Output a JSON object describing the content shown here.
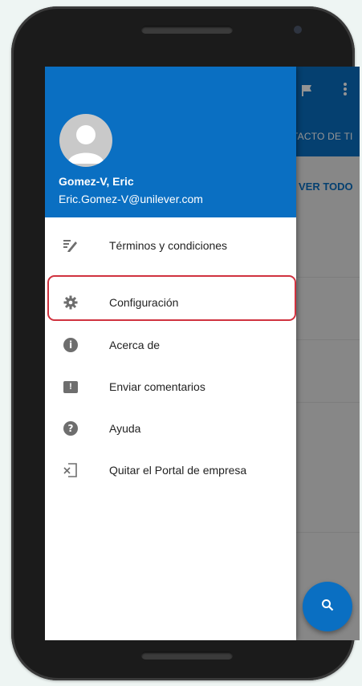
{
  "background_app": {
    "tab_label": "TACTO DE TI",
    "see_all_label": "VER TODO",
    "flag_icon": "flag-icon",
    "more_icon": "more-vert-icon",
    "fab_icon": "search-icon"
  },
  "drawer": {
    "user": {
      "name": "Gomez-V, Eric",
      "email": "Eric.Gomez-V@unilever.com",
      "avatar_icon": "avatar-placeholder-icon"
    },
    "items": [
      {
        "label": "Términos y condiciones",
        "icon": "terms-edit-icon"
      },
      {
        "label": "Configuración",
        "icon": "gear-icon",
        "highlighted": true
      },
      {
        "label": "Acerca de",
        "icon": "info-icon"
      },
      {
        "label": "Enviar comentarios",
        "icon": "feedback-icon"
      },
      {
        "label": "Ayuda",
        "icon": "help-icon"
      },
      {
        "label": "Quitar el Portal de empresa",
        "icon": "remove-portal-icon"
      }
    ]
  },
  "colors": {
    "brand_blue": "#0a6fc2",
    "highlight_red": "#d0323f"
  }
}
